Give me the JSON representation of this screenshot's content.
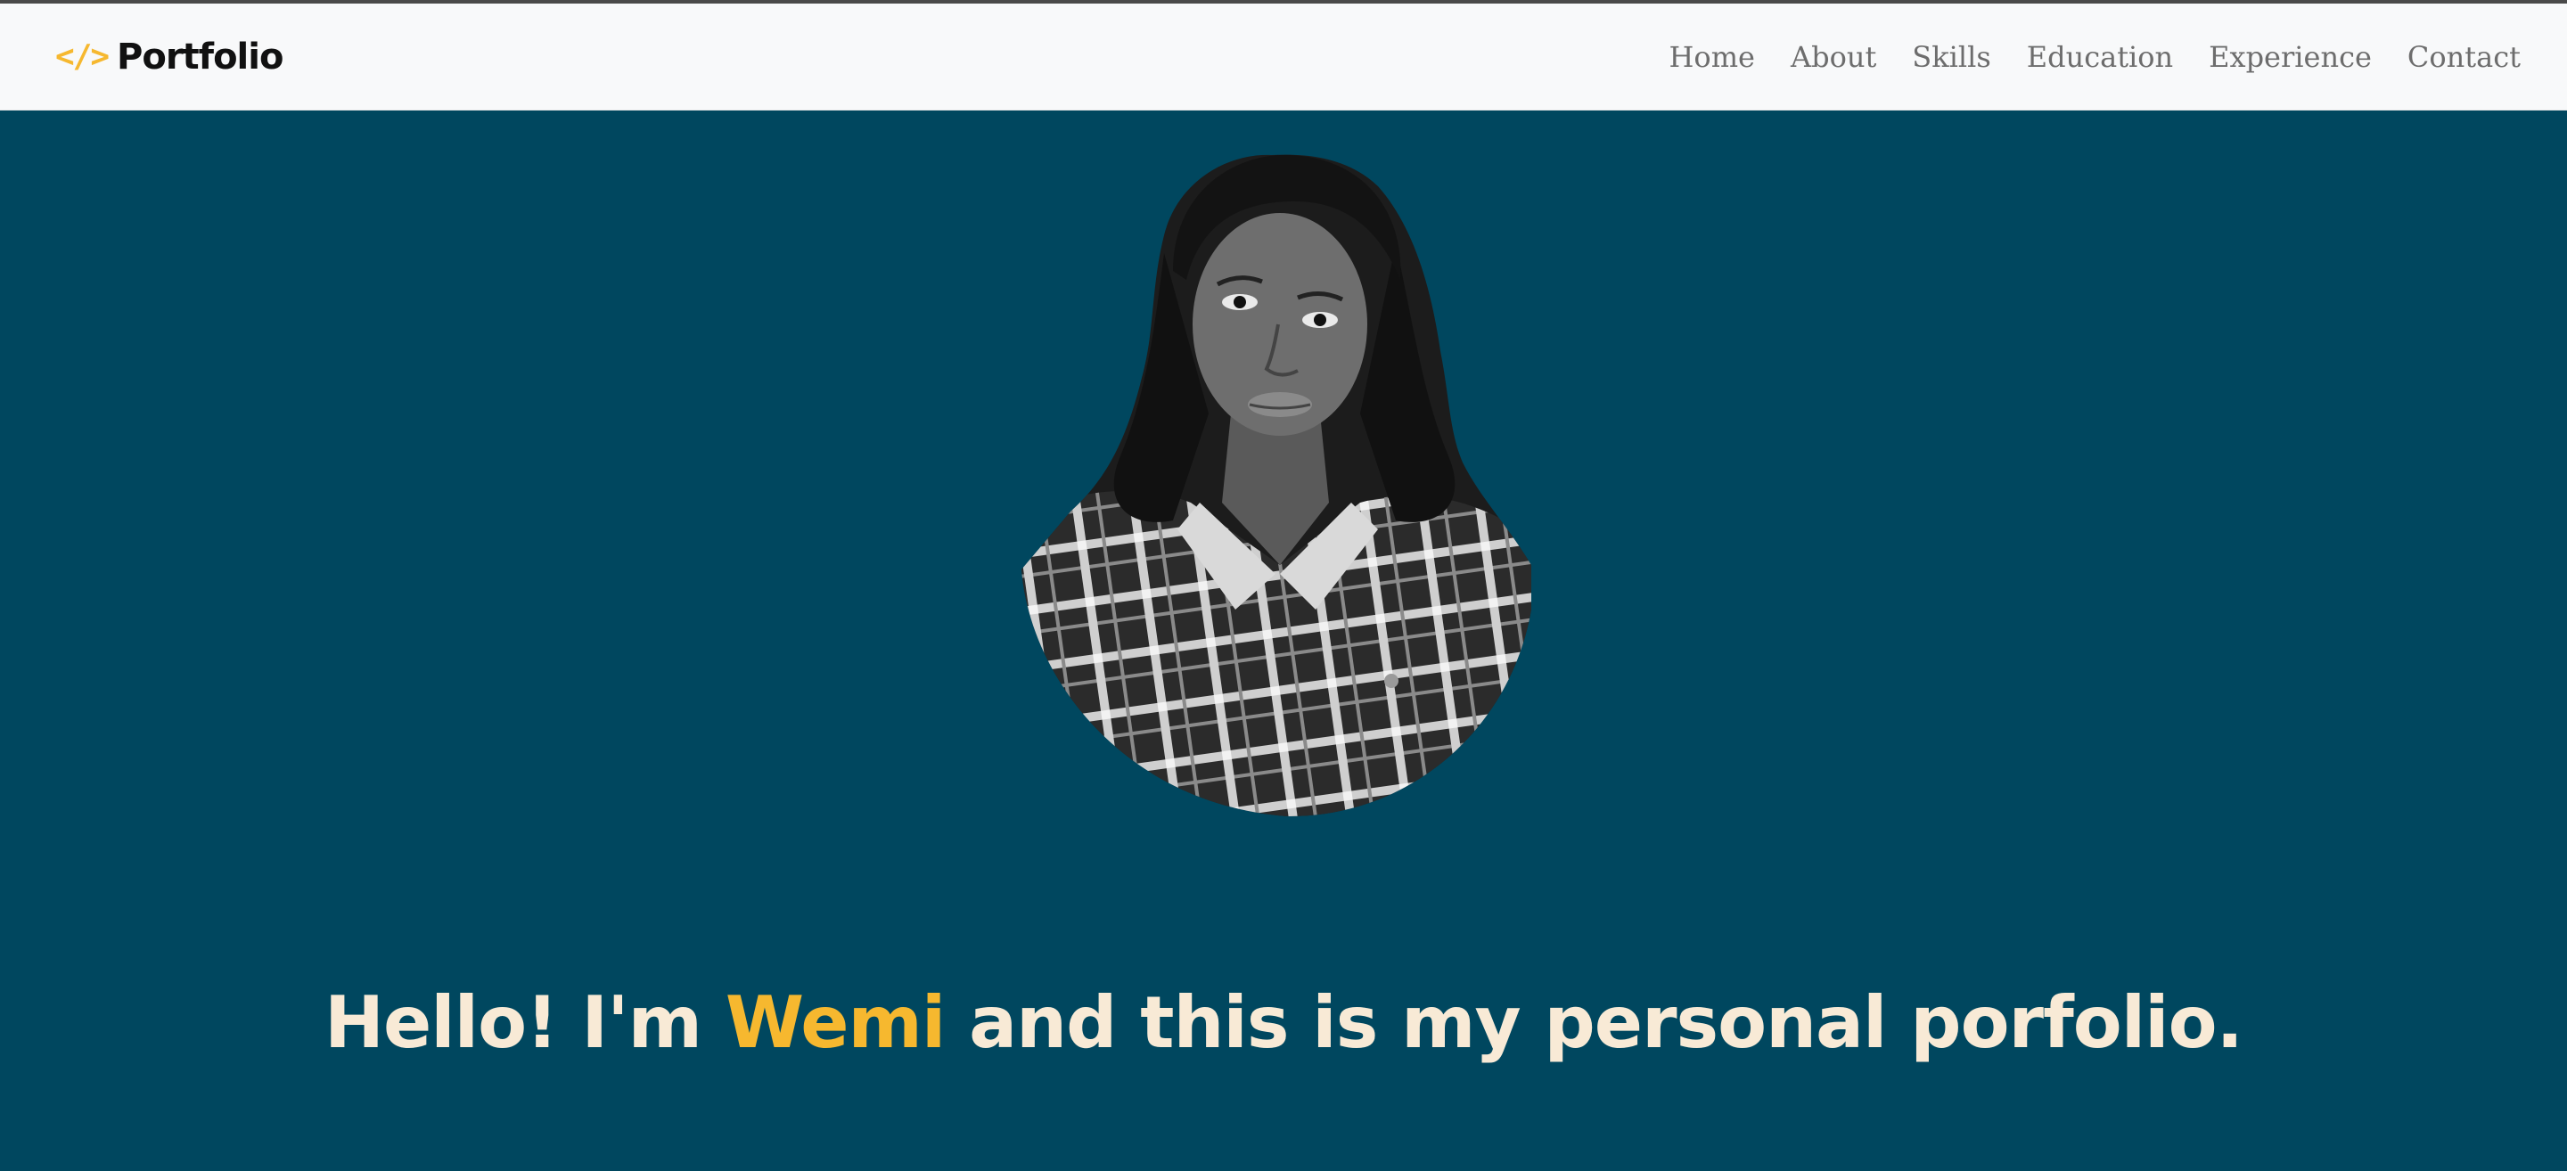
{
  "brand": {
    "icon": "</>",
    "text": "Portfolio"
  },
  "nav": {
    "items": [
      {
        "label": "Home"
      },
      {
        "label": "About"
      },
      {
        "label": "Skills"
      },
      {
        "label": "Education"
      },
      {
        "label": "Experience"
      },
      {
        "label": "Contact"
      }
    ]
  },
  "hero": {
    "photo_icon": "profile-photo",
    "headline_before": "Hello! I'm ",
    "headline_name": "Wemi",
    "headline_after": " and this is my personal porfolio."
  },
  "colors": {
    "hero_background": "#00475f",
    "navbar_background": "#f8f9fa",
    "accent": "#f6b82f",
    "headline_text": "#f8ead6",
    "nav_text": "#6d6d6d"
  }
}
